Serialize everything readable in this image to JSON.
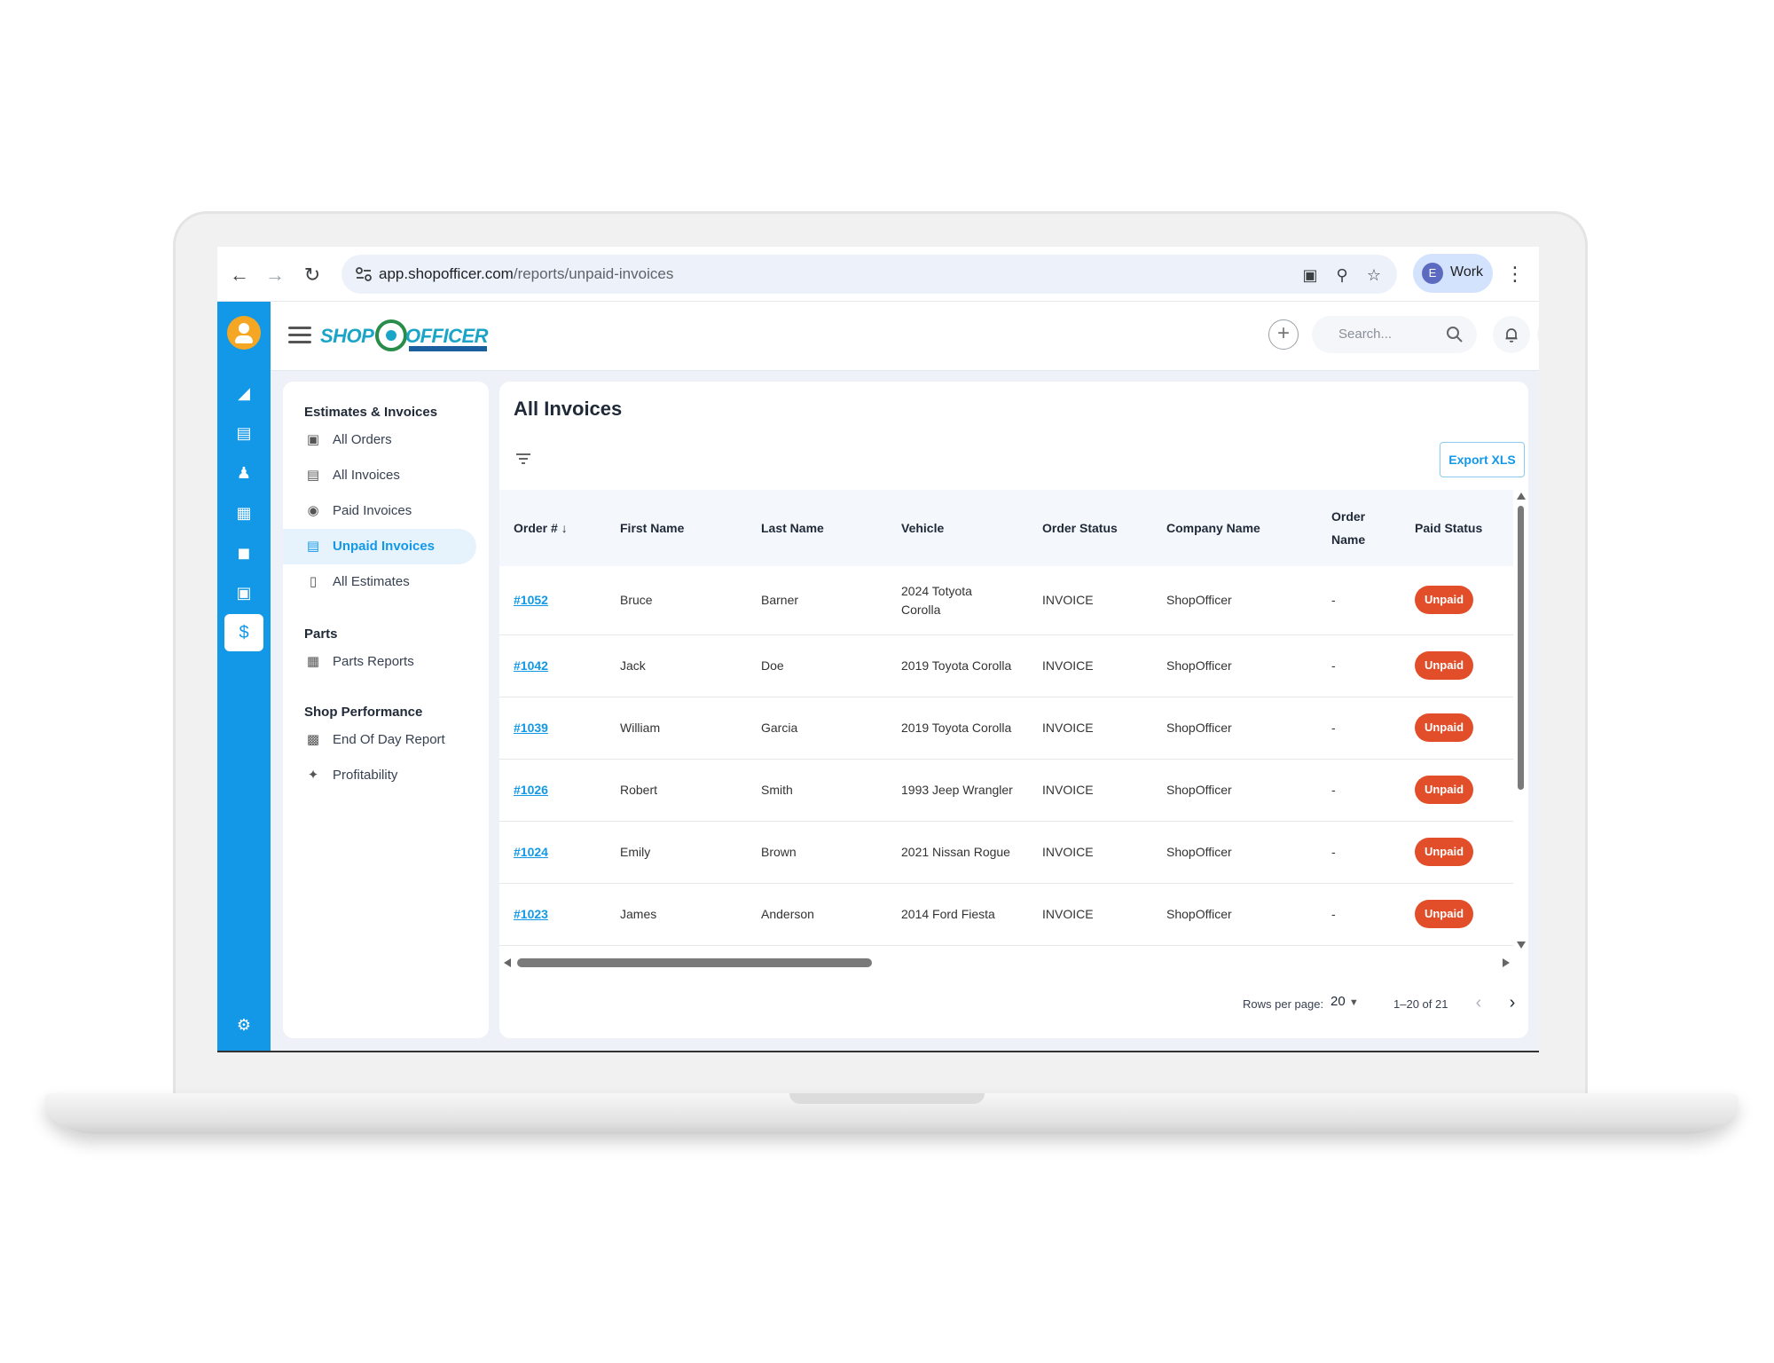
{
  "browser": {
    "url_host": "app.shopofficer.com",
    "url_path": "/reports/unpaid-invoices",
    "profile_initial": "E",
    "profile_label": "Work"
  },
  "header": {
    "logo_left": "SHOP",
    "logo_right": "OFFICER",
    "search_placeholder": "Search..."
  },
  "sidebar": {
    "sections": [
      {
        "title": "Estimates & Invoices",
        "items": [
          {
            "label": "All Orders",
            "icon": "box-icon"
          },
          {
            "label": "All Invoices",
            "icon": "document-icon"
          },
          {
            "label": "Paid Invoices",
            "icon": "dollar-icon"
          },
          {
            "label": "Unpaid Invoices",
            "icon": "list-icon",
            "active": true
          },
          {
            "label": "All Estimates",
            "icon": "file-icon"
          }
        ]
      },
      {
        "title": "Parts",
        "items": [
          {
            "label": "Parts Reports",
            "icon": "report-icon"
          }
        ]
      },
      {
        "title": "Shop Performance",
        "items": [
          {
            "label": "End Of Day Report",
            "icon": "bar-chart-icon"
          },
          {
            "label": "Profitability",
            "icon": "trend-icon"
          }
        ]
      }
    ]
  },
  "main": {
    "title": "All Invoices",
    "export_label": "Export XLS",
    "columns": {
      "order": "Order #",
      "first_name": "First Name",
      "last_name": "Last Name",
      "vehicle": "Vehicle",
      "order_status": "Order Status",
      "company_name": "Company Name",
      "order_name_1": "Order",
      "order_name_2": "Name",
      "paid_status": "Paid Status"
    },
    "rows": [
      {
        "order": "#1052",
        "first": "Bruce",
        "last": "Barner",
        "vehicle_1": "2024 Totyota",
        "vehicle_2": "Corolla",
        "status": "INVOICE",
        "company": "ShopOfficer",
        "order_name": "-",
        "paid": "Unpaid"
      },
      {
        "order": "#1042",
        "first": "Jack",
        "last": "Doe",
        "vehicle_1": "2019 Toyota Corolla",
        "vehicle_2": "",
        "status": "INVOICE",
        "company": "ShopOfficer",
        "order_name": "-",
        "paid": "Unpaid"
      },
      {
        "order": "#1039",
        "first": "William",
        "last": "Garcia",
        "vehicle_1": "2019 Toyota Corolla",
        "vehicle_2": "",
        "status": "INVOICE",
        "company": "ShopOfficer",
        "order_name": "-",
        "paid": "Unpaid"
      },
      {
        "order": "#1026",
        "first": "Robert",
        "last": "Smith",
        "vehicle_1": "1993 Jeep Wrangler",
        "vehicle_2": "",
        "status": "INVOICE",
        "company": "ShopOfficer",
        "order_name": "-",
        "paid": "Unpaid"
      },
      {
        "order": "#1024",
        "first": "Emily",
        "last": "Brown",
        "vehicle_1": "2021 Nissan Rogue",
        "vehicle_2": "",
        "status": "INVOICE",
        "company": "ShopOfficer",
        "order_name": "-",
        "paid": "Unpaid"
      },
      {
        "order": "#1023",
        "first": "James",
        "last": "Anderson",
        "vehicle_1": "2014 Ford Fiesta",
        "vehicle_2": "",
        "status": "INVOICE",
        "company": "ShopOfficer",
        "order_name": "-",
        "paid": "Unpaid"
      }
    ],
    "footer": {
      "rows_per_page_label": "Rows per page:",
      "rows_per_page_value": "20",
      "range": "1–20 of 21"
    }
  },
  "colors": {
    "accent": "#1398e8",
    "badge_unpaid": "#e24e2a",
    "content_bg": "#eef2f8"
  }
}
